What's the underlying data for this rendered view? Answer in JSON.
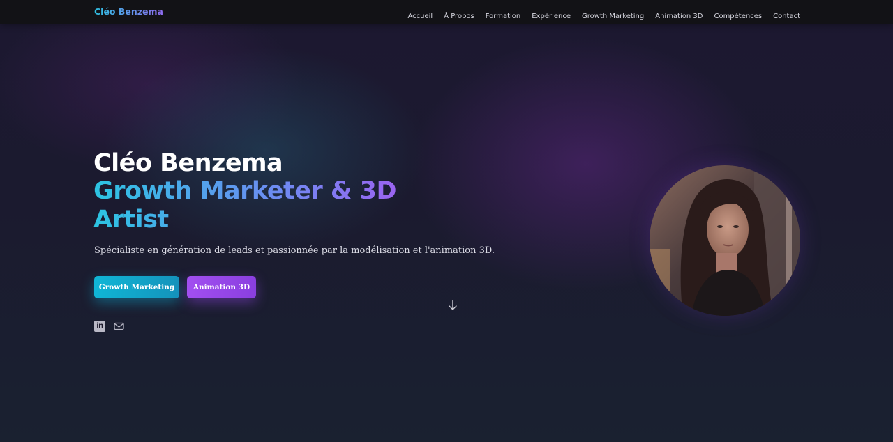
{
  "nav": {
    "brand": "Cléo Benzema",
    "links": [
      {
        "label": "Accueil"
      },
      {
        "label": "À Propos"
      },
      {
        "label": "Formation"
      },
      {
        "label": "Expérience"
      },
      {
        "label": "Growth Marketing"
      },
      {
        "label": "Animation 3D"
      },
      {
        "label": "Compétences"
      },
      {
        "label": "Contact"
      }
    ]
  },
  "hero": {
    "name": "Cléo Benzema",
    "role": "Growth Marketer & 3D Artist",
    "description": "Spécialiste en génération de leads et passionnée par la modélisation et l'animation 3D.",
    "buttons": {
      "growth_label": "Growth Marketing",
      "animation_label": "Animation 3D"
    }
  },
  "social": {
    "icons": [
      "linkedin-icon",
      "mail-icon"
    ]
  },
  "icons": {
    "scroll": "arrow-down-icon",
    "portrait": "profile-photo"
  },
  "colors": {
    "nav_bg": "#121216",
    "accent_cyan": "#2cc4e2",
    "accent_purple": "#a45cf0",
    "button_growth": "#10b6d6",
    "button_animation": "#a24ff0",
    "background": "#17162a"
  }
}
